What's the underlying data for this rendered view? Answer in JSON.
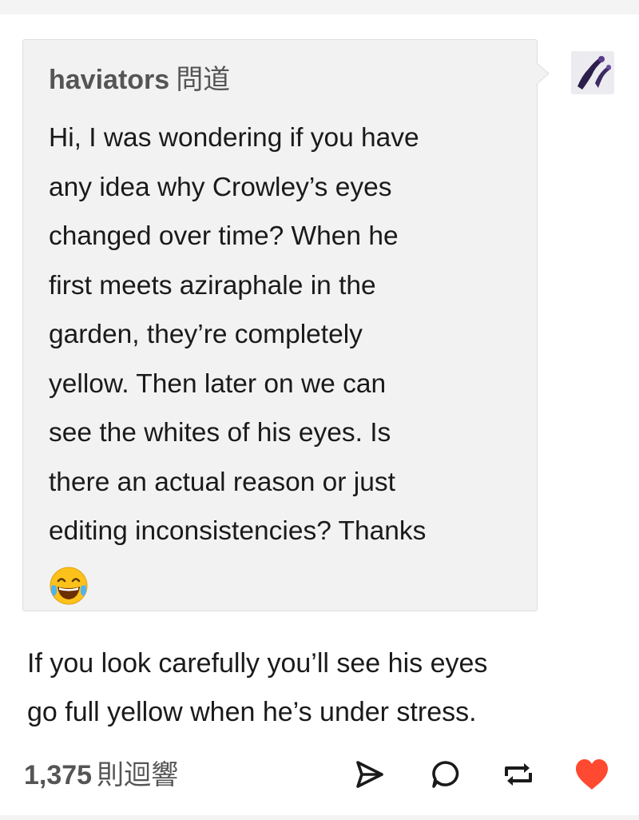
{
  "ask": {
    "asker": "haviators",
    "verb": "問道",
    "question_lines": [
      "Hi, I was wondering if you have",
      "any idea why Crowley’s eyes",
      "changed over time? When he",
      "first meets aziraphale in the",
      "garden, they’re completely",
      "yellow. Then later on we can",
      "see the whites of his eyes. Is",
      "there an actual reason or just",
      "editing inconsistencies? Thanks"
    ],
    "emoji": "face-with-tears-of-joy"
  },
  "answer_lines": [
    "If you look carefully you’ll see his eyes",
    "go full yellow when he’s under stress."
  ],
  "footer": {
    "note_count": "1,375",
    "notes_label": "則迴響",
    "icons": [
      "share-icon",
      "reply-icon",
      "reblog-icon",
      "heart-icon"
    ],
    "like_color": "#ff4930",
    "icon_color": "#1a1a1a"
  }
}
